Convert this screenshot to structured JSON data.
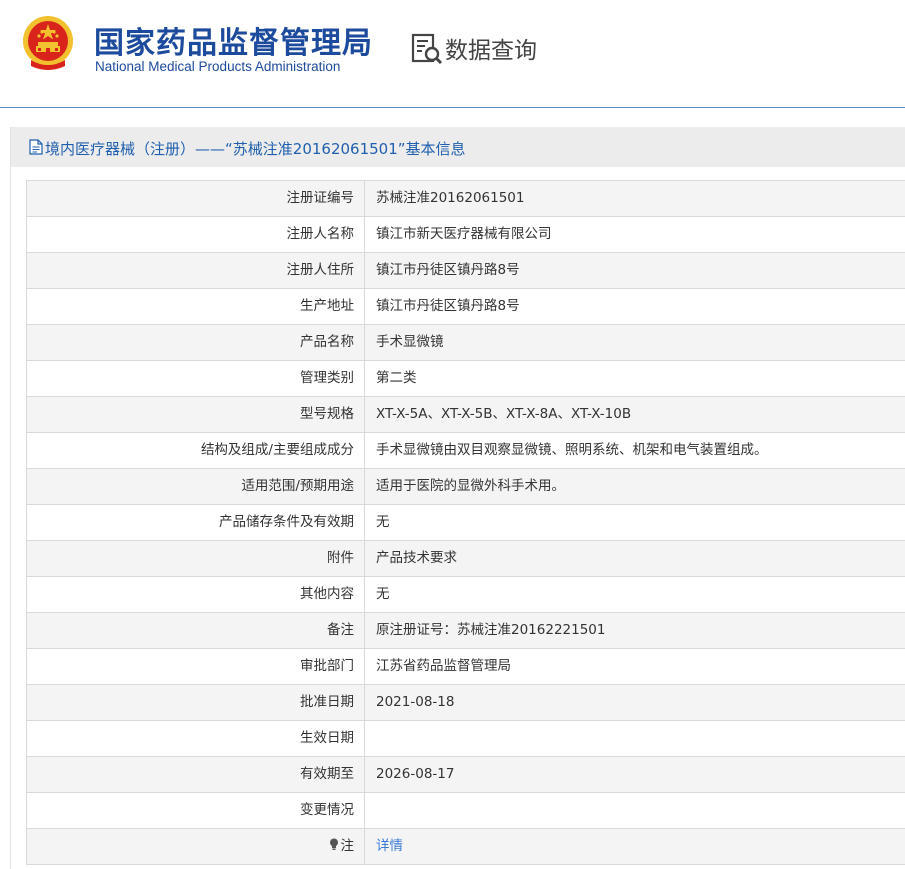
{
  "header": {
    "agency_name_cn": "国家药品监督管理局",
    "agency_name_en": "National Medical Products Administration",
    "section_label": "数据查询",
    "colors": {
      "brand_blue": "#1c4a9c",
      "emblem_red": "#d9241c",
      "emblem_gold": "#f2c12e",
      "link_blue": "#3a7bd5"
    }
  },
  "page": {
    "title": "境内医疗器械（注册）——“苏械注准20162061501”基本信息"
  },
  "table": {
    "rows": [
      {
        "label": "注册证编号",
        "value": "苏械注准20162061501"
      },
      {
        "label": "注册人名称",
        "value": "镇江市新天医疗器械有限公司"
      },
      {
        "label": "注册人住所",
        "value": "镇江市丹徒区镇丹路8号"
      },
      {
        "label": "生产地址",
        "value": "镇江市丹徒区镇丹路8号"
      },
      {
        "label": "产品名称",
        "value": "手术显微镜"
      },
      {
        "label": "管理类别",
        "value": "第二类"
      },
      {
        "label": "型号规格",
        "value": "XT-X-5A、XT-X-5B、XT-X-8A、XT-X-10B"
      },
      {
        "label": "结构及组成/主要组成成分",
        "value": "手术显微镜由双目观察显微镜、照明系统、机架和电气装置组成。"
      },
      {
        "label": "适用范围/预期用途",
        "value": "适用于医院的显微外科手术用。"
      },
      {
        "label": "产品储存条件及有效期",
        "value": "无"
      },
      {
        "label": "附件",
        "value": "产品技术要求"
      },
      {
        "label": "其他内容",
        "value": "无"
      },
      {
        "label": "备注",
        "value": "原注册证号：苏械注准20162221501"
      },
      {
        "label": "审批部门",
        "value": "江苏省药品监督管理局"
      },
      {
        "label": "批准日期",
        "value": "2021-08-18"
      },
      {
        "label": "生效日期",
        "value": ""
      },
      {
        "label": "有效期至",
        "value": "2026-08-17"
      },
      {
        "label": "变更情况",
        "value": ""
      }
    ],
    "note_row": {
      "label": "注",
      "icon": "lightbulb-icon",
      "link_text": "详情"
    }
  }
}
